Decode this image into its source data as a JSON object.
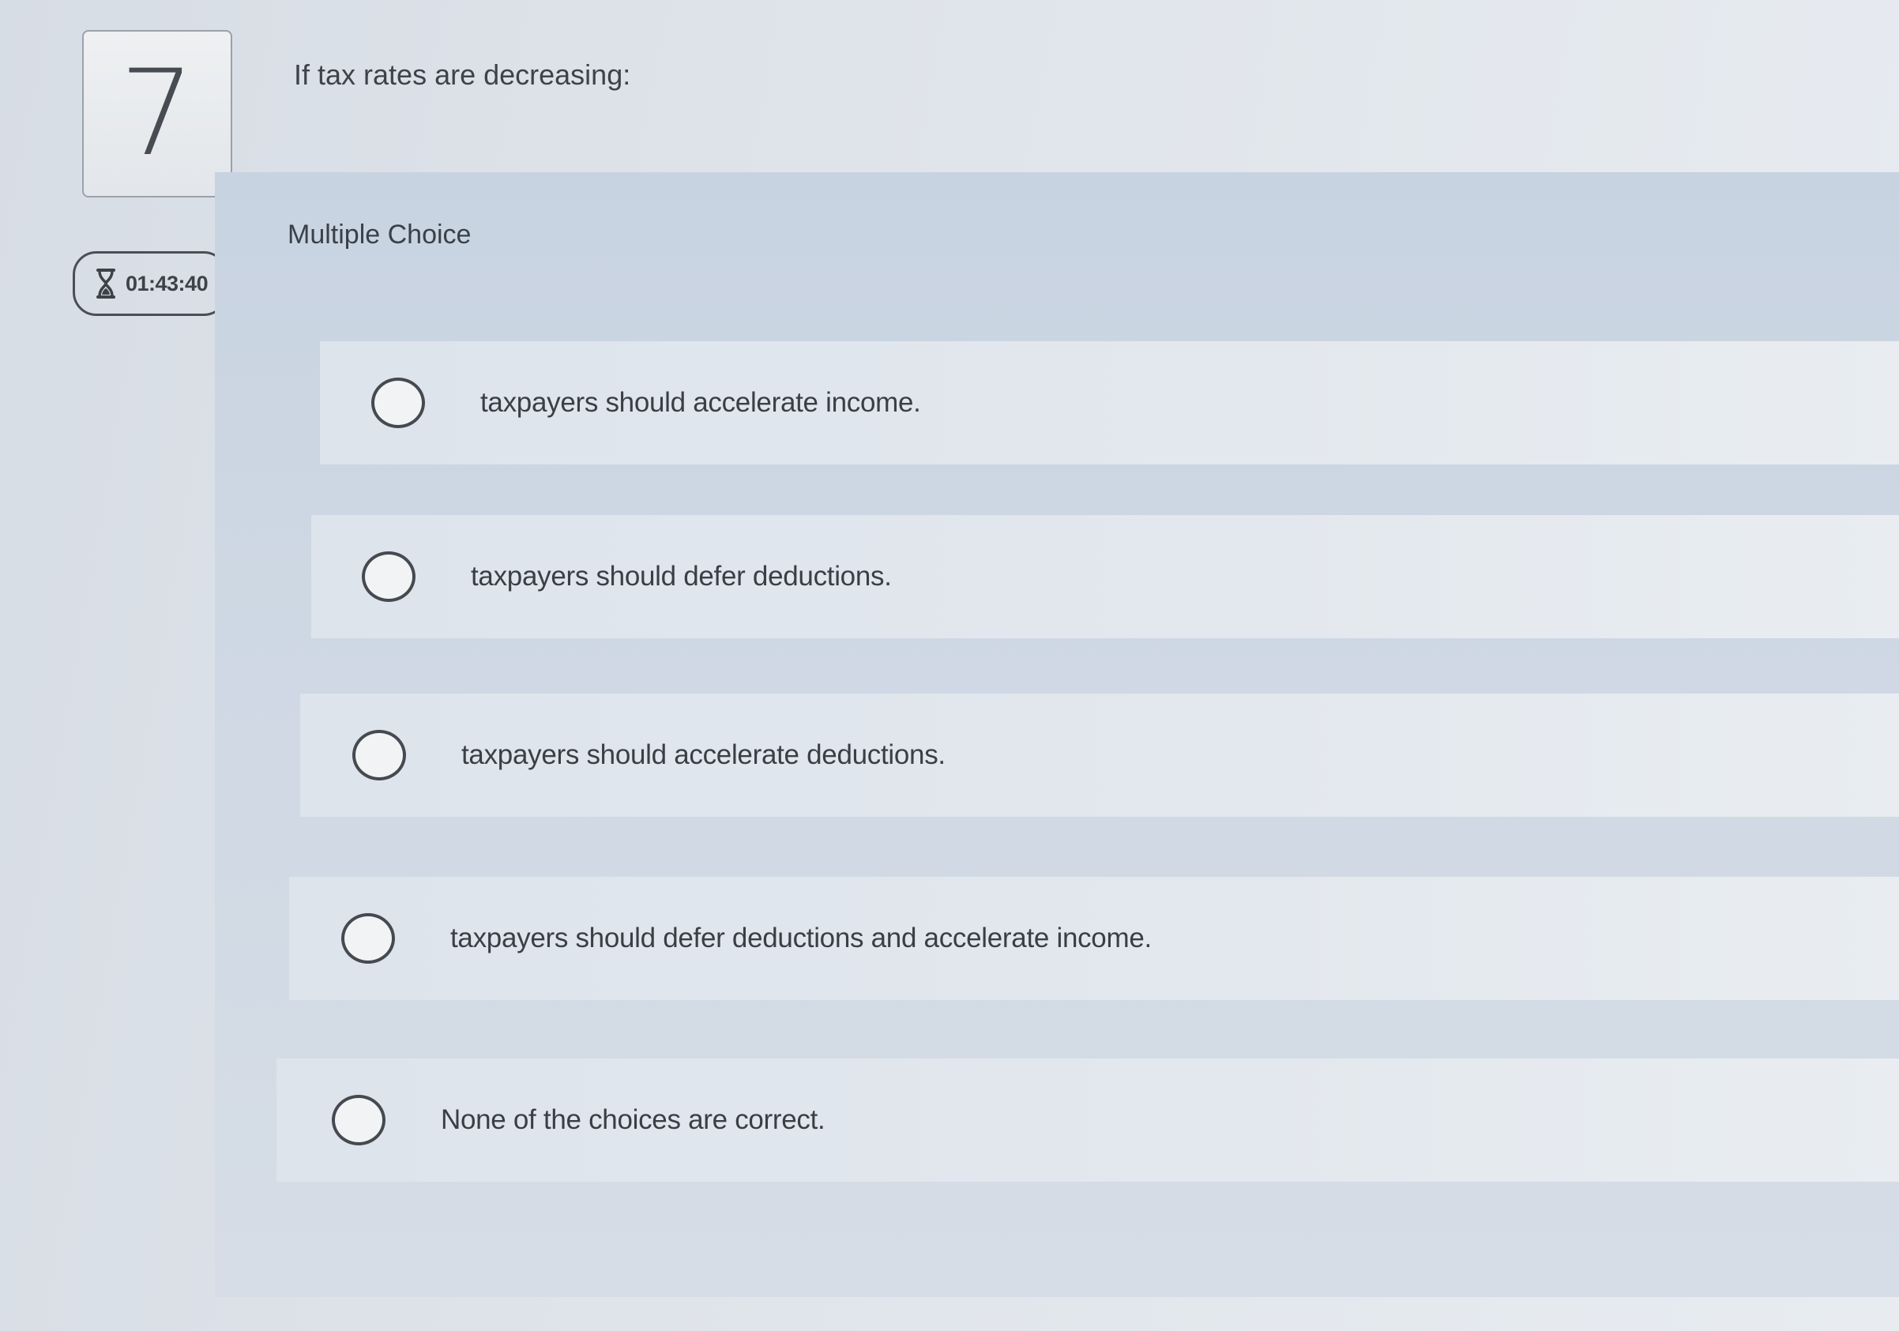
{
  "question": {
    "number": "7",
    "prompt": "If tax rates are decreasing:"
  },
  "timer": {
    "icon": "hourglass-icon",
    "value": "01:43:40"
  },
  "panel": {
    "header": "Multiple Choice"
  },
  "options": [
    {
      "label": "taxpayers should accelerate income."
    },
    {
      "label": "taxpayers should defer deductions."
    },
    {
      "label": "taxpayers should accelerate deductions."
    },
    {
      "label": "taxpayers should defer deductions and accelerate income."
    },
    {
      "label": "None of the choices are correct."
    }
  ]
}
